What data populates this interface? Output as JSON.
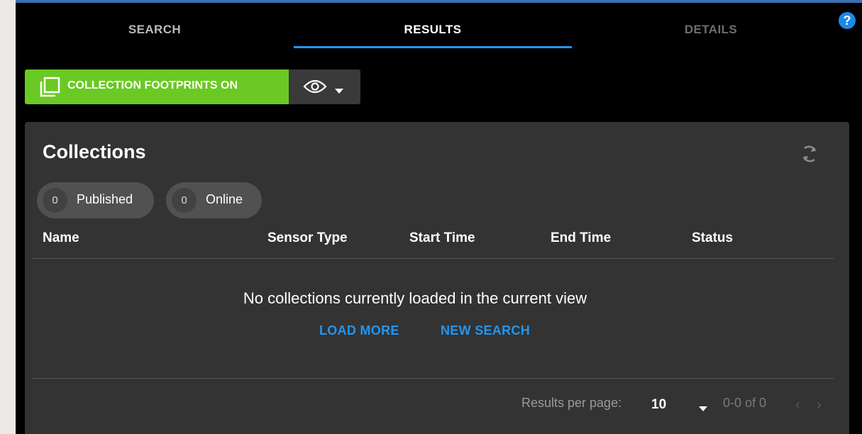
{
  "tabs": [
    {
      "label": "SEARCH"
    },
    {
      "label": "RESULTS"
    },
    {
      "label": "DETAILS"
    }
  ],
  "active_tab": "RESULTS",
  "help": {
    "label": "?"
  },
  "toolbar": {
    "footprints_label": "COLLECTION FOOTPRINTS ON",
    "footprints_icon": "layers-icon",
    "visibility_icon": "eye-icon"
  },
  "collections": {
    "title": "Collections",
    "refresh_icon": "refresh-icon",
    "chips": [
      {
        "count": "0",
        "label": "Published"
      },
      {
        "count": "0",
        "label": "Online"
      }
    ],
    "columns": [
      "Name",
      "Sensor Type",
      "Start Time",
      "End Time",
      "Status"
    ],
    "rows": [],
    "empty_message": "No collections currently loaded in the current view",
    "load_more_label": "LOAD MORE",
    "new_search_label": "NEW SEARCH"
  },
  "pagination": {
    "label": "Results per page:",
    "per_page": "10",
    "range": "0-0 of 0",
    "prev": "‹",
    "next": "›"
  },
  "colors": {
    "accent": "#2196f3",
    "toggle_on": "#6ac922",
    "background": "#000000",
    "card": "#333333"
  }
}
